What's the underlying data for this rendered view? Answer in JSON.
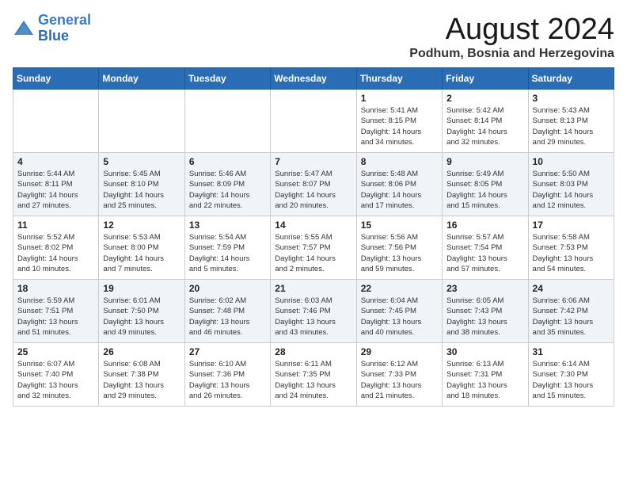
{
  "header": {
    "logo_line1": "General",
    "logo_line2": "Blue",
    "month_year": "August 2024",
    "location": "Podhum, Bosnia and Herzegovina"
  },
  "days_of_week": [
    "Sunday",
    "Monday",
    "Tuesday",
    "Wednesday",
    "Thursday",
    "Friday",
    "Saturday"
  ],
  "weeks": [
    [
      {
        "day": "",
        "info": ""
      },
      {
        "day": "",
        "info": ""
      },
      {
        "day": "",
        "info": ""
      },
      {
        "day": "",
        "info": ""
      },
      {
        "day": "1",
        "info": "Sunrise: 5:41 AM\nSunset: 8:15 PM\nDaylight: 14 hours\nand 34 minutes."
      },
      {
        "day": "2",
        "info": "Sunrise: 5:42 AM\nSunset: 8:14 PM\nDaylight: 14 hours\nand 32 minutes."
      },
      {
        "day": "3",
        "info": "Sunrise: 5:43 AM\nSunset: 8:13 PM\nDaylight: 14 hours\nand 29 minutes."
      }
    ],
    [
      {
        "day": "4",
        "info": "Sunrise: 5:44 AM\nSunset: 8:11 PM\nDaylight: 14 hours\nand 27 minutes."
      },
      {
        "day": "5",
        "info": "Sunrise: 5:45 AM\nSunset: 8:10 PM\nDaylight: 14 hours\nand 25 minutes."
      },
      {
        "day": "6",
        "info": "Sunrise: 5:46 AM\nSunset: 8:09 PM\nDaylight: 14 hours\nand 22 minutes."
      },
      {
        "day": "7",
        "info": "Sunrise: 5:47 AM\nSunset: 8:07 PM\nDaylight: 14 hours\nand 20 minutes."
      },
      {
        "day": "8",
        "info": "Sunrise: 5:48 AM\nSunset: 8:06 PM\nDaylight: 14 hours\nand 17 minutes."
      },
      {
        "day": "9",
        "info": "Sunrise: 5:49 AM\nSunset: 8:05 PM\nDaylight: 14 hours\nand 15 minutes."
      },
      {
        "day": "10",
        "info": "Sunrise: 5:50 AM\nSunset: 8:03 PM\nDaylight: 14 hours\nand 12 minutes."
      }
    ],
    [
      {
        "day": "11",
        "info": "Sunrise: 5:52 AM\nSunset: 8:02 PM\nDaylight: 14 hours\nand 10 minutes."
      },
      {
        "day": "12",
        "info": "Sunrise: 5:53 AM\nSunset: 8:00 PM\nDaylight: 14 hours\nand 7 minutes."
      },
      {
        "day": "13",
        "info": "Sunrise: 5:54 AM\nSunset: 7:59 PM\nDaylight: 14 hours\nand 5 minutes."
      },
      {
        "day": "14",
        "info": "Sunrise: 5:55 AM\nSunset: 7:57 PM\nDaylight: 14 hours\nand 2 minutes."
      },
      {
        "day": "15",
        "info": "Sunrise: 5:56 AM\nSunset: 7:56 PM\nDaylight: 13 hours\nand 59 minutes."
      },
      {
        "day": "16",
        "info": "Sunrise: 5:57 AM\nSunset: 7:54 PM\nDaylight: 13 hours\nand 57 minutes."
      },
      {
        "day": "17",
        "info": "Sunrise: 5:58 AM\nSunset: 7:53 PM\nDaylight: 13 hours\nand 54 minutes."
      }
    ],
    [
      {
        "day": "18",
        "info": "Sunrise: 5:59 AM\nSunset: 7:51 PM\nDaylight: 13 hours\nand 51 minutes."
      },
      {
        "day": "19",
        "info": "Sunrise: 6:01 AM\nSunset: 7:50 PM\nDaylight: 13 hours\nand 49 minutes."
      },
      {
        "day": "20",
        "info": "Sunrise: 6:02 AM\nSunset: 7:48 PM\nDaylight: 13 hours\nand 46 minutes."
      },
      {
        "day": "21",
        "info": "Sunrise: 6:03 AM\nSunset: 7:46 PM\nDaylight: 13 hours\nand 43 minutes."
      },
      {
        "day": "22",
        "info": "Sunrise: 6:04 AM\nSunset: 7:45 PM\nDaylight: 13 hours\nand 40 minutes."
      },
      {
        "day": "23",
        "info": "Sunrise: 6:05 AM\nSunset: 7:43 PM\nDaylight: 13 hours\nand 38 minutes."
      },
      {
        "day": "24",
        "info": "Sunrise: 6:06 AM\nSunset: 7:42 PM\nDaylight: 13 hours\nand 35 minutes."
      }
    ],
    [
      {
        "day": "25",
        "info": "Sunrise: 6:07 AM\nSunset: 7:40 PM\nDaylight: 13 hours\nand 32 minutes."
      },
      {
        "day": "26",
        "info": "Sunrise: 6:08 AM\nSunset: 7:38 PM\nDaylight: 13 hours\nand 29 minutes."
      },
      {
        "day": "27",
        "info": "Sunrise: 6:10 AM\nSunset: 7:36 PM\nDaylight: 13 hours\nand 26 minutes."
      },
      {
        "day": "28",
        "info": "Sunrise: 6:11 AM\nSunset: 7:35 PM\nDaylight: 13 hours\nand 24 minutes."
      },
      {
        "day": "29",
        "info": "Sunrise: 6:12 AM\nSunset: 7:33 PM\nDaylight: 13 hours\nand 21 minutes."
      },
      {
        "day": "30",
        "info": "Sunrise: 6:13 AM\nSunset: 7:31 PM\nDaylight: 13 hours\nand 18 minutes."
      },
      {
        "day": "31",
        "info": "Sunrise: 6:14 AM\nSunset: 7:30 PM\nDaylight: 13 hours\nand 15 minutes."
      }
    ]
  ]
}
